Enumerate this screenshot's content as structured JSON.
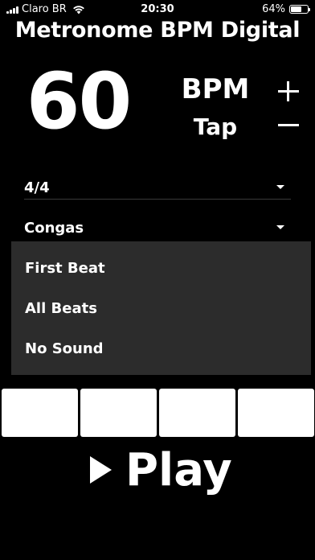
{
  "status_bar": {
    "carrier": "Claro BR",
    "time": "20:30",
    "battery_text": "64%",
    "battery_level": 0.64,
    "icons": [
      "signal-bars-icon",
      "wifi-icon",
      "battery-icon"
    ]
  },
  "app": {
    "title": "Metronome BPM Digital"
  },
  "tempo": {
    "bpm": "60",
    "unit_label": "BPM",
    "tap_label": "Tap",
    "increase_icon": "plus-icon",
    "decrease_icon": "minus-icon"
  },
  "controls": {
    "time_signature": "4/4",
    "sound": "Congas",
    "caret_icon": "caret-down-icon"
  },
  "dropdown": {
    "items": [
      {
        "label": "First Beat"
      },
      {
        "label": "All Beats"
      },
      {
        "label": "No Sound"
      }
    ]
  },
  "beats": {
    "count": 4,
    "color": "#ffffff"
  },
  "playback": {
    "label": "Play",
    "icon": "play-icon"
  },
  "colors": {
    "background": "#000000",
    "text": "#ffffff",
    "menu_background": "#2c2c2c"
  }
}
